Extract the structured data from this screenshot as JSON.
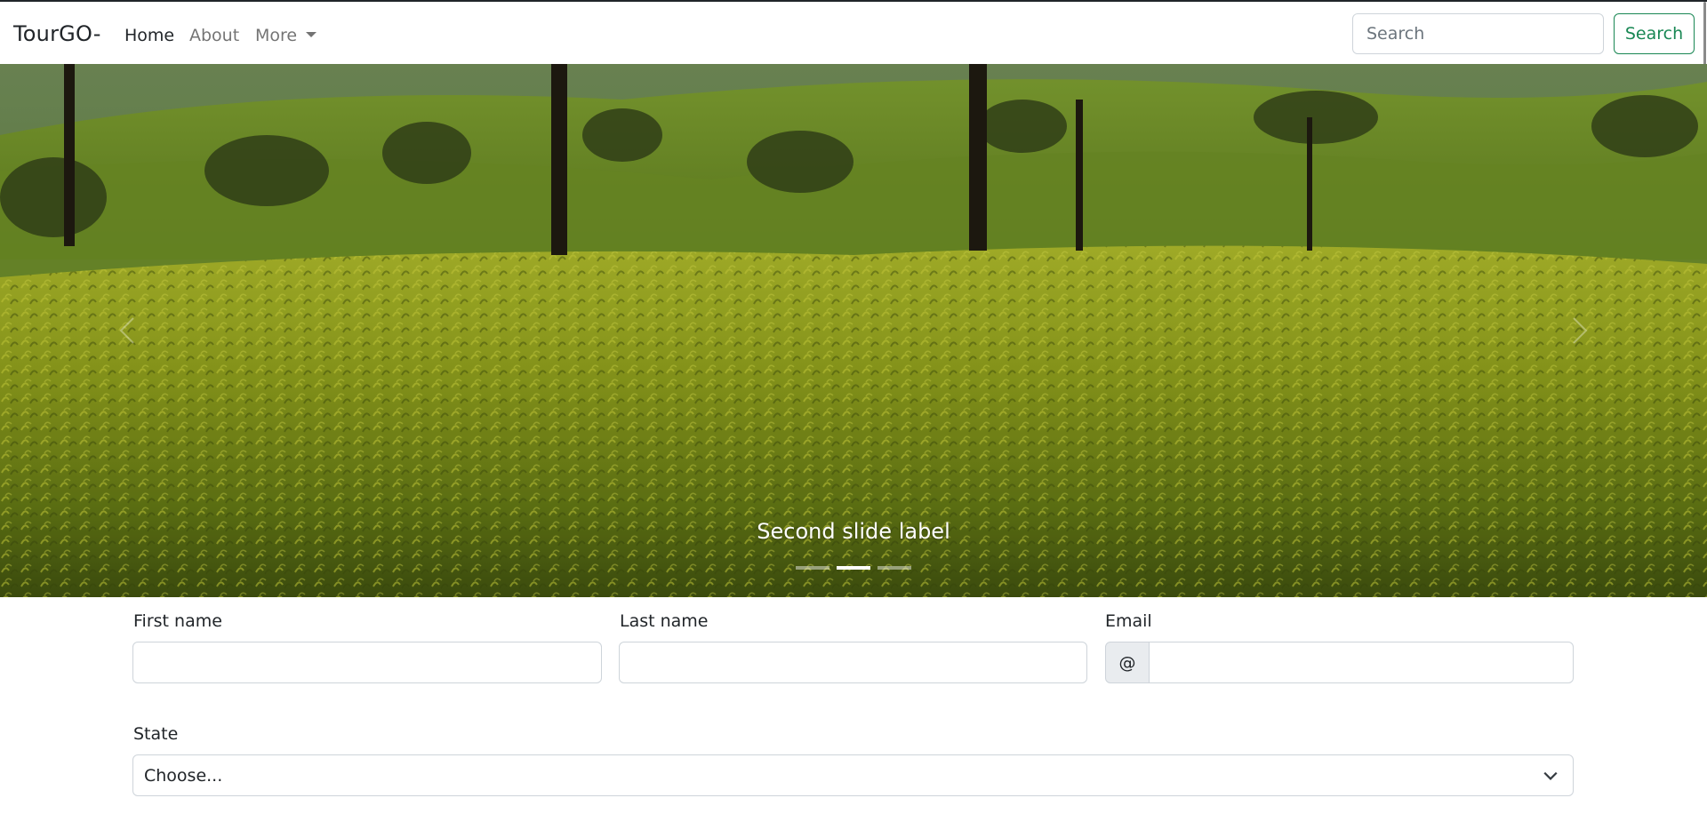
{
  "navbar": {
    "brand": "TourGO-",
    "links": {
      "home": "Home",
      "about": "About",
      "more": "More"
    },
    "search_placeholder": "Search",
    "search_button": "Search",
    "accent_color": "#198754"
  },
  "carousel": {
    "caption": "Second slide label",
    "slide_count": 3,
    "active_slide": 2,
    "image_description_icon": "tea-plantation-image"
  },
  "form": {
    "first_name_label": "First name",
    "last_name_label": "Last name",
    "email_label": "Email",
    "email_prefix": "@",
    "state_label": "State",
    "state_selected": "Choose..."
  }
}
